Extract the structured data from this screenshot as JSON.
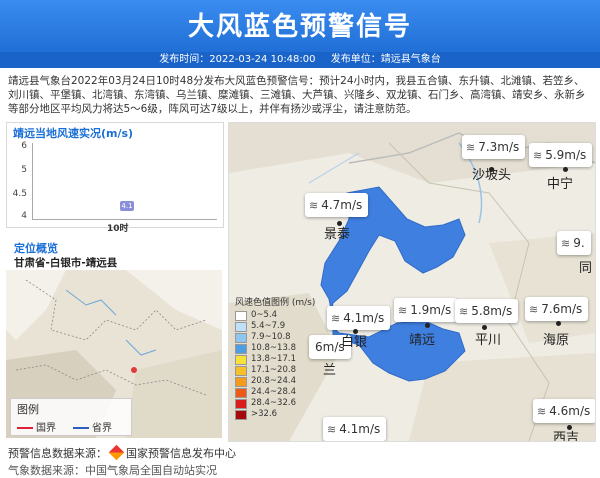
{
  "header": {
    "title": "大风蓝色预警信号",
    "publish_time_label": "发布时间：2022-03-24 10:48:00",
    "publisher_label": "发布单位：靖远县气象台"
  },
  "description": "靖远县气象台2022年03月24日10时48分发布大风蓝色预警信号：预计24小时内，我县五合镇、东升镇、北滩镇、若笠乡、刘川镇、平堡镇、北湾镇、东湾镇、乌兰镇、糜滩镇、三滩镇、大芦镇、兴隆乡、双龙镇、石门乡、高湾镇、靖安乡、永新乡等部分地区平均风力将达5～6级，阵风可达7级以上，并伴有扬沙或浮尘，请注意防范。",
  "wind_panel": {
    "title": "靖远当地风速实况(m/s)",
    "y_ticks": [
      "6",
      "5",
      "4.5",
      "4"
    ],
    "x_tick": "10时",
    "point_label": "4.1"
  },
  "chart_data": {
    "type": "line",
    "title": "靖远当地风速实况(m/s)",
    "x": [
      "10时"
    ],
    "series": [
      {
        "values": [
          4.1
        ]
      }
    ],
    "ylim": [
      4,
      6
    ]
  },
  "location": {
    "title": "定位概览",
    "name": "甘肃省-白银市-靖远县"
  },
  "minimap_legend": {
    "title": "图例",
    "national": "国界",
    "provincial": "省界"
  },
  "map": {
    "legend_title": "风速色值图例 (m/s)",
    "legend_rows": [
      {
        "label": "0~5.4",
        "color": "#ffffff"
      },
      {
        "label": "5.4~7.9",
        "color": "#bfe0f7"
      },
      {
        "label": "7.9~10.8",
        "color": "#8fc6ef"
      },
      {
        "label": "10.8~13.8",
        "color": "#4f9fe0"
      },
      {
        "label": "13.8~17.1",
        "color": "#f7e23a"
      },
      {
        "label": "17.1~20.8",
        "color": "#f7c028"
      },
      {
        "label": "20.8~24.4",
        "color": "#f49a1c"
      },
      {
        "label": "24.4~28.4",
        "color": "#ec5a1a"
      },
      {
        "label": "28.4~32.6",
        "color": "#d91c1c"
      },
      {
        "label": ">32.6",
        "color": "#a30b0b"
      }
    ],
    "stations": [
      {
        "value": "7.3m/s"
      },
      {
        "value": "5.9m/s"
      },
      {
        "value": "4.7m/s"
      },
      {
        "value": "9."
      },
      {
        "value": "1.9m/s"
      },
      {
        "value": "4.1m/s"
      },
      {
        "value": "5.8m/s"
      },
      {
        "value": "7.6m/s"
      },
      {
        "value": "6m/s"
      },
      {
        "value": "4.6m/s"
      },
      {
        "value": "4.1m/s"
      }
    ],
    "cities": [
      "沙坡头",
      "中宁",
      "景泰",
      "同",
      "白银",
      "靖远",
      "平川",
      "海原",
      "兰",
      "西吉"
    ]
  },
  "footer": {
    "source_label": "预警信息数据来源：",
    "source_name": "国家预警信息发布中心",
    "second_line": "气象数据来源：中国气象局全国自动站实况"
  },
  "colors": {
    "banner": "#2f7fe0",
    "warning_region": "#3f7fe0",
    "accent": "#1a6fd6"
  }
}
